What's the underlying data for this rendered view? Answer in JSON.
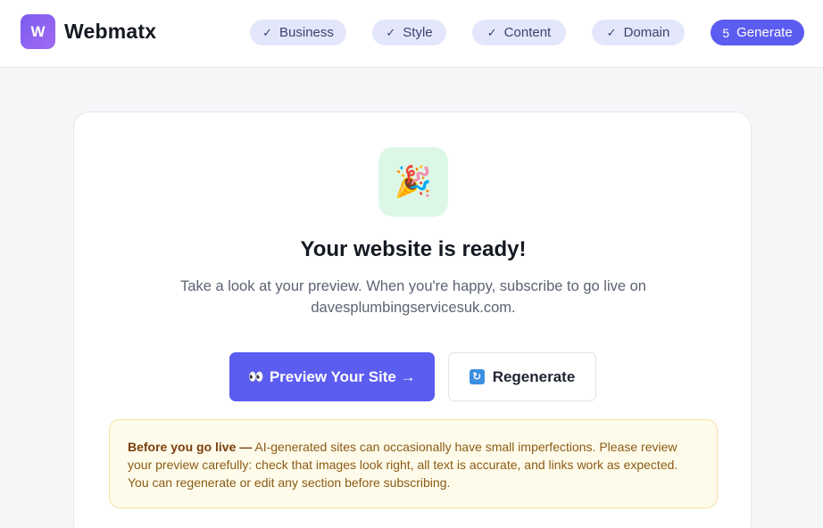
{
  "header": {
    "logo_letter": "W",
    "brand": "Webmatx",
    "steps": [
      {
        "label": "Business",
        "state": "done"
      },
      {
        "label": "Style",
        "state": "done"
      },
      {
        "label": "Content",
        "state": "done"
      },
      {
        "label": "Domain",
        "state": "done"
      },
      {
        "number": "5",
        "label": "Generate",
        "state": "active"
      }
    ]
  },
  "main": {
    "icon": "party-popper-icon",
    "icon_glyph": "🎉",
    "title": "Your website is ready!",
    "subtitle": "Take a look at your preview. When you're happy, subscribe to go live on davesplumbingservicesuk.com.",
    "preview_button": {
      "icon": "eyes-icon",
      "icon_glyph": "👀",
      "label": "Preview Your Site →"
    },
    "regenerate_button": {
      "icon": "refresh-icon",
      "icon_glyph": "🔄",
      "label": "Regenerate"
    },
    "notice": {
      "heading": "Before you go live —",
      "body": " AI-generated sites can occasionally have small imperfections. Please review your preview carefully: check that images look right, all text is accurate, and links work as expected. You can regenerate or edit any section before subscribing."
    }
  },
  "colors": {
    "accent": "#5b5cf0",
    "step_pill_bg": "#e4e7fb",
    "success_tile": "#ddf7e6",
    "notice_bg": "#fffbea",
    "notice_text": "#8a5b14"
  }
}
